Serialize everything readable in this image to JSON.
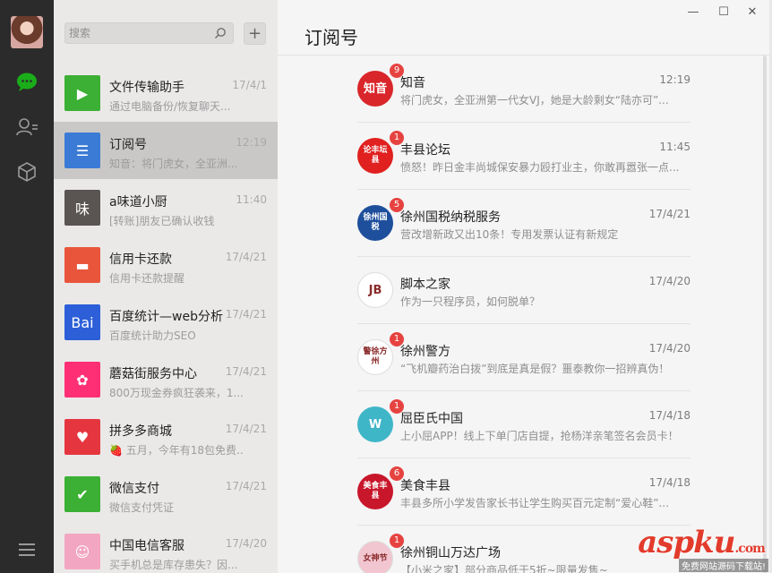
{
  "nav": {
    "icons": [
      "avatar",
      "chat-icon",
      "contacts-icon",
      "favorites-icon",
      "menu-icon"
    ]
  },
  "search": {
    "placeholder": "搜索"
  },
  "conversations": [
    {
      "name": "文件传输助手",
      "time": "17/4/1",
      "preview": "通过电脑备份/恢复聊天...",
      "color": "#3cb034"
    },
    {
      "name": "订阅号",
      "time": "12:19",
      "preview": "知音：将门虎女，全亚洲...",
      "color": "#3b7bd6"
    },
    {
      "name": "a味道小厨",
      "time": "11:40",
      "preview": "[转账]朋友已确认收钱",
      "color": "#5a5552"
    },
    {
      "name": "信用卡还款",
      "time": "17/4/21",
      "preview": "信用卡还款提醒",
      "color": "#e9553b"
    },
    {
      "name": "百度统计—web分析",
      "time": "17/4/21",
      "preview": "百度统计助力SEO",
      "color": "#2c5fd8"
    },
    {
      "name": "蘑菇街服务中心",
      "time": "17/4/21",
      "preview": "800万现金券疯狂袭来，1...",
      "color": "#ff2f75"
    },
    {
      "name": "拼多多商城",
      "time": "17/4/21",
      "preview": "🍓 五月，今年有18包免费...",
      "color": "#e5363f"
    },
    {
      "name": "微信支付",
      "time": "17/4/21",
      "preview": "微信支付凭证",
      "color": "#3cb034"
    },
    {
      "name": "中国电信客服",
      "time": "17/4/20",
      "preview": "买手机总是库存患失？因...",
      "color": "#f3a6c1"
    }
  ],
  "main": {
    "title": "订阅号",
    "window_controls": {
      "minimize": "—",
      "maximize": "☐",
      "close": "✕"
    }
  },
  "subscriptions": [
    {
      "name": "知音",
      "time": "12:19",
      "preview": "将门虎女，全亚洲第一代女VJ，她是大龄剩女“陆亦可”...",
      "badge": "9",
      "color": "#d9262a",
      "icon_text": "知音"
    },
    {
      "name": "丰县论坛",
      "time": "11:45",
      "preview": "愤怒！昨日金丰尚城保安暴力殴打业主，你敢再嚣张一点...",
      "badge": "1",
      "color": "#e0211f",
      "icon_text": "论丰坛县"
    },
    {
      "name": "徐州国税纳税服务",
      "time": "17/4/21",
      "preview": "营改增新政又出10条！专用发票认证有新规定",
      "badge": "5",
      "color": "#1e4f9c",
      "icon_text": "徐州国税"
    },
    {
      "name": "脚本之家",
      "time": "17/4/20",
      "preview": "作为一只程序员，如何脱单？",
      "badge": "",
      "color": "#ffffff",
      "icon_text": "JB"
    },
    {
      "name": "徐州警方",
      "time": "17/4/20",
      "preview": "“飞机瓣药治白拨”到底是真是假？噩泰教你一招辨真伪！",
      "badge": "1",
      "color": "#ffffff",
      "icon_text": "警徐方州"
    },
    {
      "name": "屈臣氏中国",
      "time": "17/4/18",
      "preview": "上小屈APP！线上下单门店自提，抢杨洋亲笔签名会员卡！",
      "badge": "1",
      "color": "#3fb6c8",
      "icon_text": "W"
    },
    {
      "name": "美食丰县",
      "time": "17/4/18",
      "preview": "丰县多所小学发告家长书让学生购买百元定制“爱心鞋”...",
      "badge": "6",
      "color": "#c8162b",
      "icon_text": "美食丰县"
    },
    {
      "name": "徐州铜山万达广场",
      "time": "",
      "preview": "【小米之家】部分商品低于5折~限量发售~",
      "badge": "1",
      "color": "#f1c6d0",
      "icon_text": "女神节"
    }
  ],
  "watermark": {
    "logo": "aspku",
    "suffix": ".com",
    "tagline": "免费网站源码下载站!"
  }
}
